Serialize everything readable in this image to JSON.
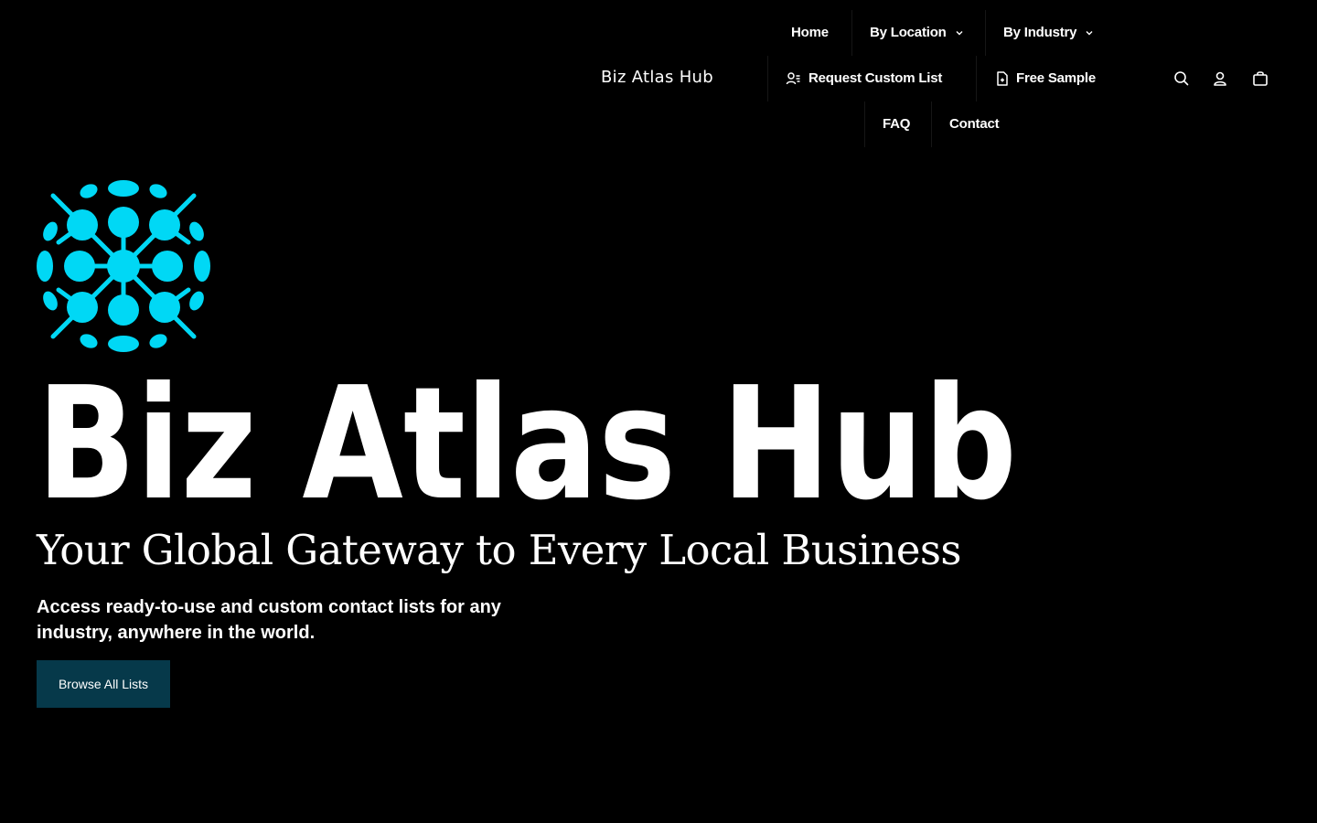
{
  "header": {
    "brand": "Biz Atlas Hub",
    "nav": {
      "home": "Home",
      "by_location": "By Location",
      "by_industry": "By Industry",
      "request_custom_list": "Request Custom List",
      "free_sample": "Free Sample",
      "faq": "FAQ",
      "contact": "Contact"
    },
    "icons": {
      "search": "search-icon",
      "account": "user-icon",
      "cart": "bag-icon"
    }
  },
  "hero": {
    "logo_text": "Biz Atlas Hub",
    "headline": "Your Global Gateway to Every Local Business",
    "subheadline": "Access ready-to-use and custom contact lists for any industry, anywhere in the world.",
    "cta_label": "Browse All Lists"
  },
  "colors": {
    "background": "#000000",
    "accent_cyan": "#00d8f5",
    "button": "#06394a",
    "text": "#ffffff"
  }
}
